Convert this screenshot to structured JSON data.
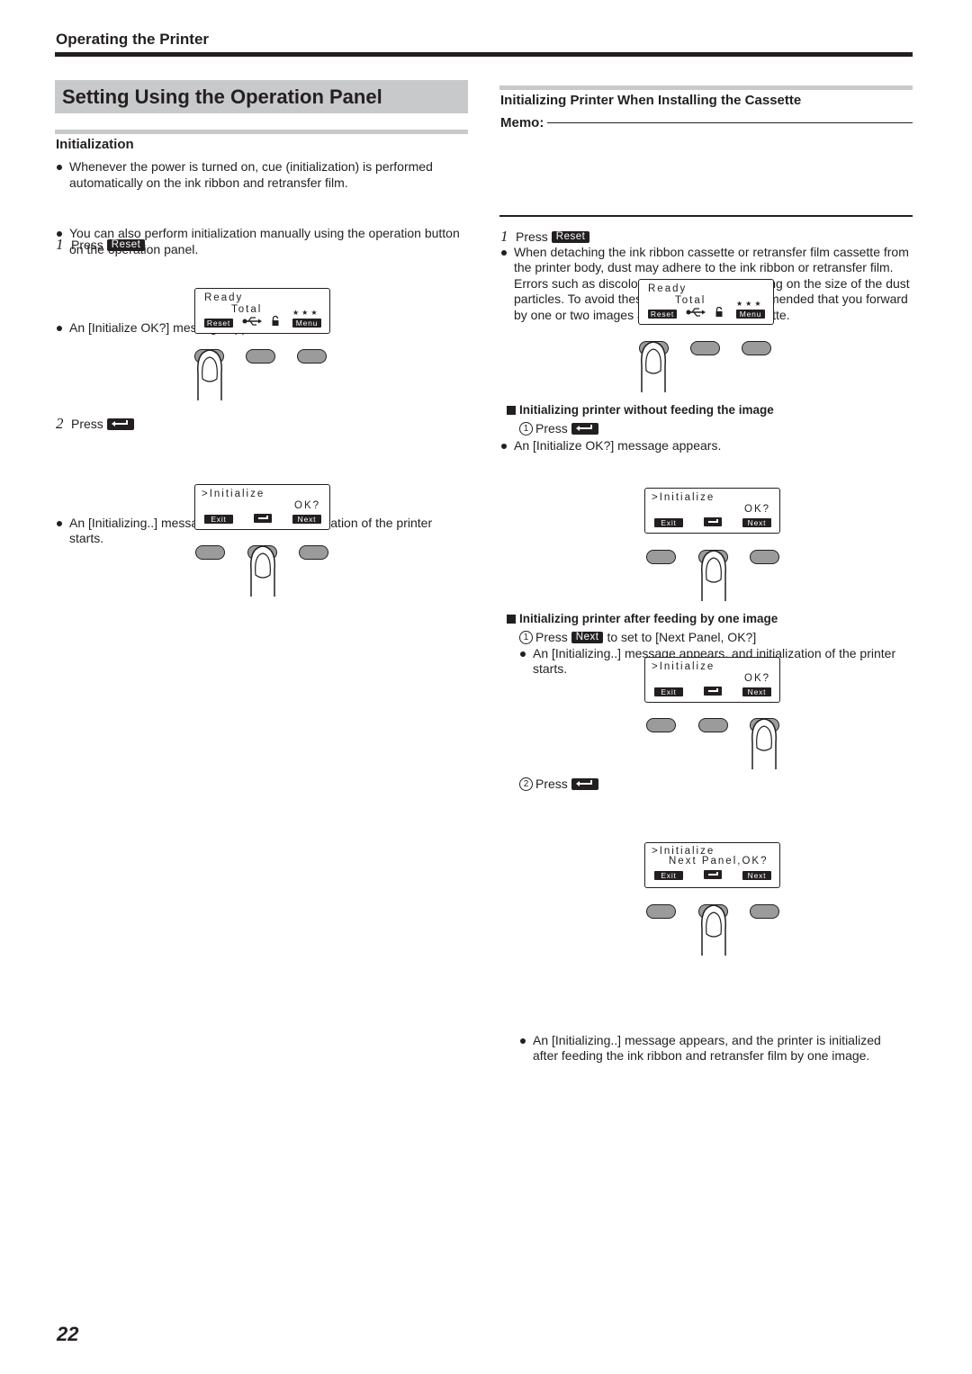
{
  "header": {
    "running_title": "Operating the Printer"
  },
  "section_title": "Setting Using the Operation Panel",
  "left": {
    "heading": "Initialization",
    "bullets": [
      "Whenever the power is turned on, cue (initialization) is performed automatically on the ink ribbon and retransfer film.",
      "You can also perform initialization manually using the operation button on the operation panel."
    ],
    "steps": [
      {
        "num": "1",
        "press_label": "Press",
        "key": "Reset",
        "key_icon": "reset-key",
        "result": "An [Initialize OK?] message appears."
      },
      {
        "num": "2",
        "press_label": "Press",
        "key": "",
        "key_icon": "enter-key-icon",
        "result": "An [Initializing..] message appears, and initialization of the printer starts."
      }
    ]
  },
  "right": {
    "heading": "Initializing Printer When Installing the Cassette",
    "memo_label": "Memo:",
    "memo_text": "When detaching the ink ribbon cassette or retransfer film cassette from the printer body, dust may adhere to the ink ribbon or retransfer film. Errors such as discoloring may occur depending on the size of the dust particles. To avoid these problems, it is recommended that you forward by one or two images after installing the cassette.",
    "step1": {
      "num": "1",
      "press_label": "Press",
      "key": "Reset",
      "result": "An [Initialize OK?] message appears."
    },
    "sub_a": {
      "title": "Initializing printer without feeding the image",
      "step": {
        "circ": "1",
        "press_label": "Press",
        "key_icon": "enter-key-icon",
        "result": "An [Initializing..] message appears, and initialization of the printer starts."
      }
    },
    "sub_b": {
      "title": "Initializing printer after feeding by one image",
      "step1": {
        "circ": "1",
        "press_label": "Press",
        "key": "Next",
        "suffix": "to set to [Next Panel, OK?]"
      },
      "step2": {
        "circ": "2",
        "press_label": "Press",
        "key_icon": "enter-key-icon",
        "result": "An [Initializing..] message appears, and the printer is initialized after feeding the ink ribbon and retransfer film by one image."
      }
    }
  },
  "lcd": {
    "ready": {
      "line1": "Ready",
      "line2": "Total",
      "stars": "★★★",
      "left_tag": "Reset",
      "right_tag": "Menu"
    },
    "init_ok": {
      "line1": ">Initialize",
      "line2": "OK?",
      "left_tag": "Exit",
      "right_tag": "Next"
    },
    "init_next": {
      "line1": ">Initialize",
      "line2": "Next Panel,OK?",
      "left_tag": "Exit",
      "right_tag": "Next"
    }
  },
  "footer": {
    "page_number": "22"
  }
}
